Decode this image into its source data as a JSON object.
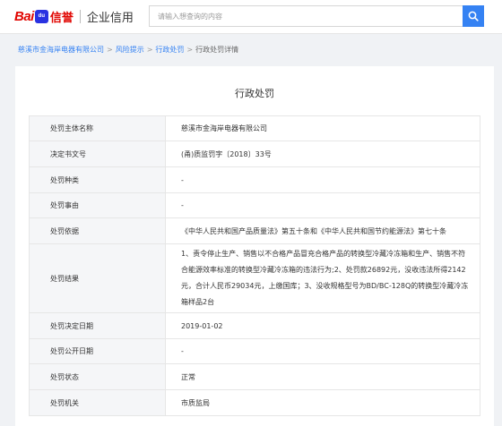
{
  "header": {
    "logo": {
      "bai": "Bai",
      "du": "du",
      "xin": "信誉",
      "sub": "企业信用"
    },
    "search": {
      "placeholder": "请输入想查询的内容",
      "value": ""
    }
  },
  "breadcrumb": {
    "items": [
      {
        "label": "慈溪市金海岸电器有限公司",
        "link": true
      },
      {
        "label": "风险提示",
        "link": true
      },
      {
        "label": "行政处罚",
        "link": true
      },
      {
        "label": "行政处罚详情",
        "link": false
      }
    ],
    "separator": ">"
  },
  "card": {
    "title": "行政处罚",
    "rows": [
      {
        "key": "处罚主体名称",
        "value": "慈溪市金海岸电器有限公司"
      },
      {
        "key": "决定书文号",
        "value": "(甬)质监罚字〔2018〕33号"
      },
      {
        "key": "处罚种类",
        "value": "-"
      },
      {
        "key": "处罚事由",
        "value": "-"
      },
      {
        "key": "处罚依据",
        "value": "《中华人民共和国产品质量法》第五十条和《中华人民共和国节约能源法》第七十条"
      },
      {
        "key": "处罚结果",
        "value": "1、责令停止生产、销售以不合格产品冒充合格产品的转换型冷藏冷冻箱和生产、销售不符合能源效率标准的转换型冷藏冷冻箱的违法行为;2、处罚款26892元，没收违法所得2142元，合计人民币29034元，上缴国库；3、没收规格型号为BD/BC-128Q的转换型冷藏冷冻箱样品2台"
      },
      {
        "key": "处罚决定日期",
        "value": "2019-01-02"
      },
      {
        "key": "处罚公开日期",
        "value": "-"
      },
      {
        "key": "处罚状态",
        "value": "正常"
      },
      {
        "key": "处罚机关",
        "value": "市质监局"
      }
    ]
  },
  "colors": {
    "accent": "#3582f3",
    "brand_red": "#e10602",
    "brand_blue": "#2932e1"
  },
  "icons": {
    "search": "search-icon"
  }
}
